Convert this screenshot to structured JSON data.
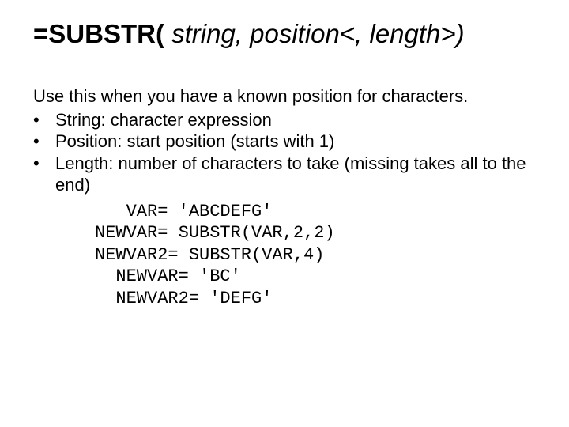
{
  "title": {
    "part1": "=SUBSTR(",
    "part2": " string, position<, length>)"
  },
  "intro": "Use this when you have a known position for characters.",
  "bullets": [
    "String:  character expression",
    "Position:  start position (starts with 1)",
    "Length:  number of characters to take (missing takes all to the end)"
  ],
  "code": [
    "   VAR= 'ABCDEFG'",
    "NEWVAR= SUBSTR(VAR,2,2)",
    "NEWVAR2= SUBSTR(VAR,4)",
    "  NEWVAR= 'BC'",
    "  NEWVAR2= 'DEFG'"
  ]
}
